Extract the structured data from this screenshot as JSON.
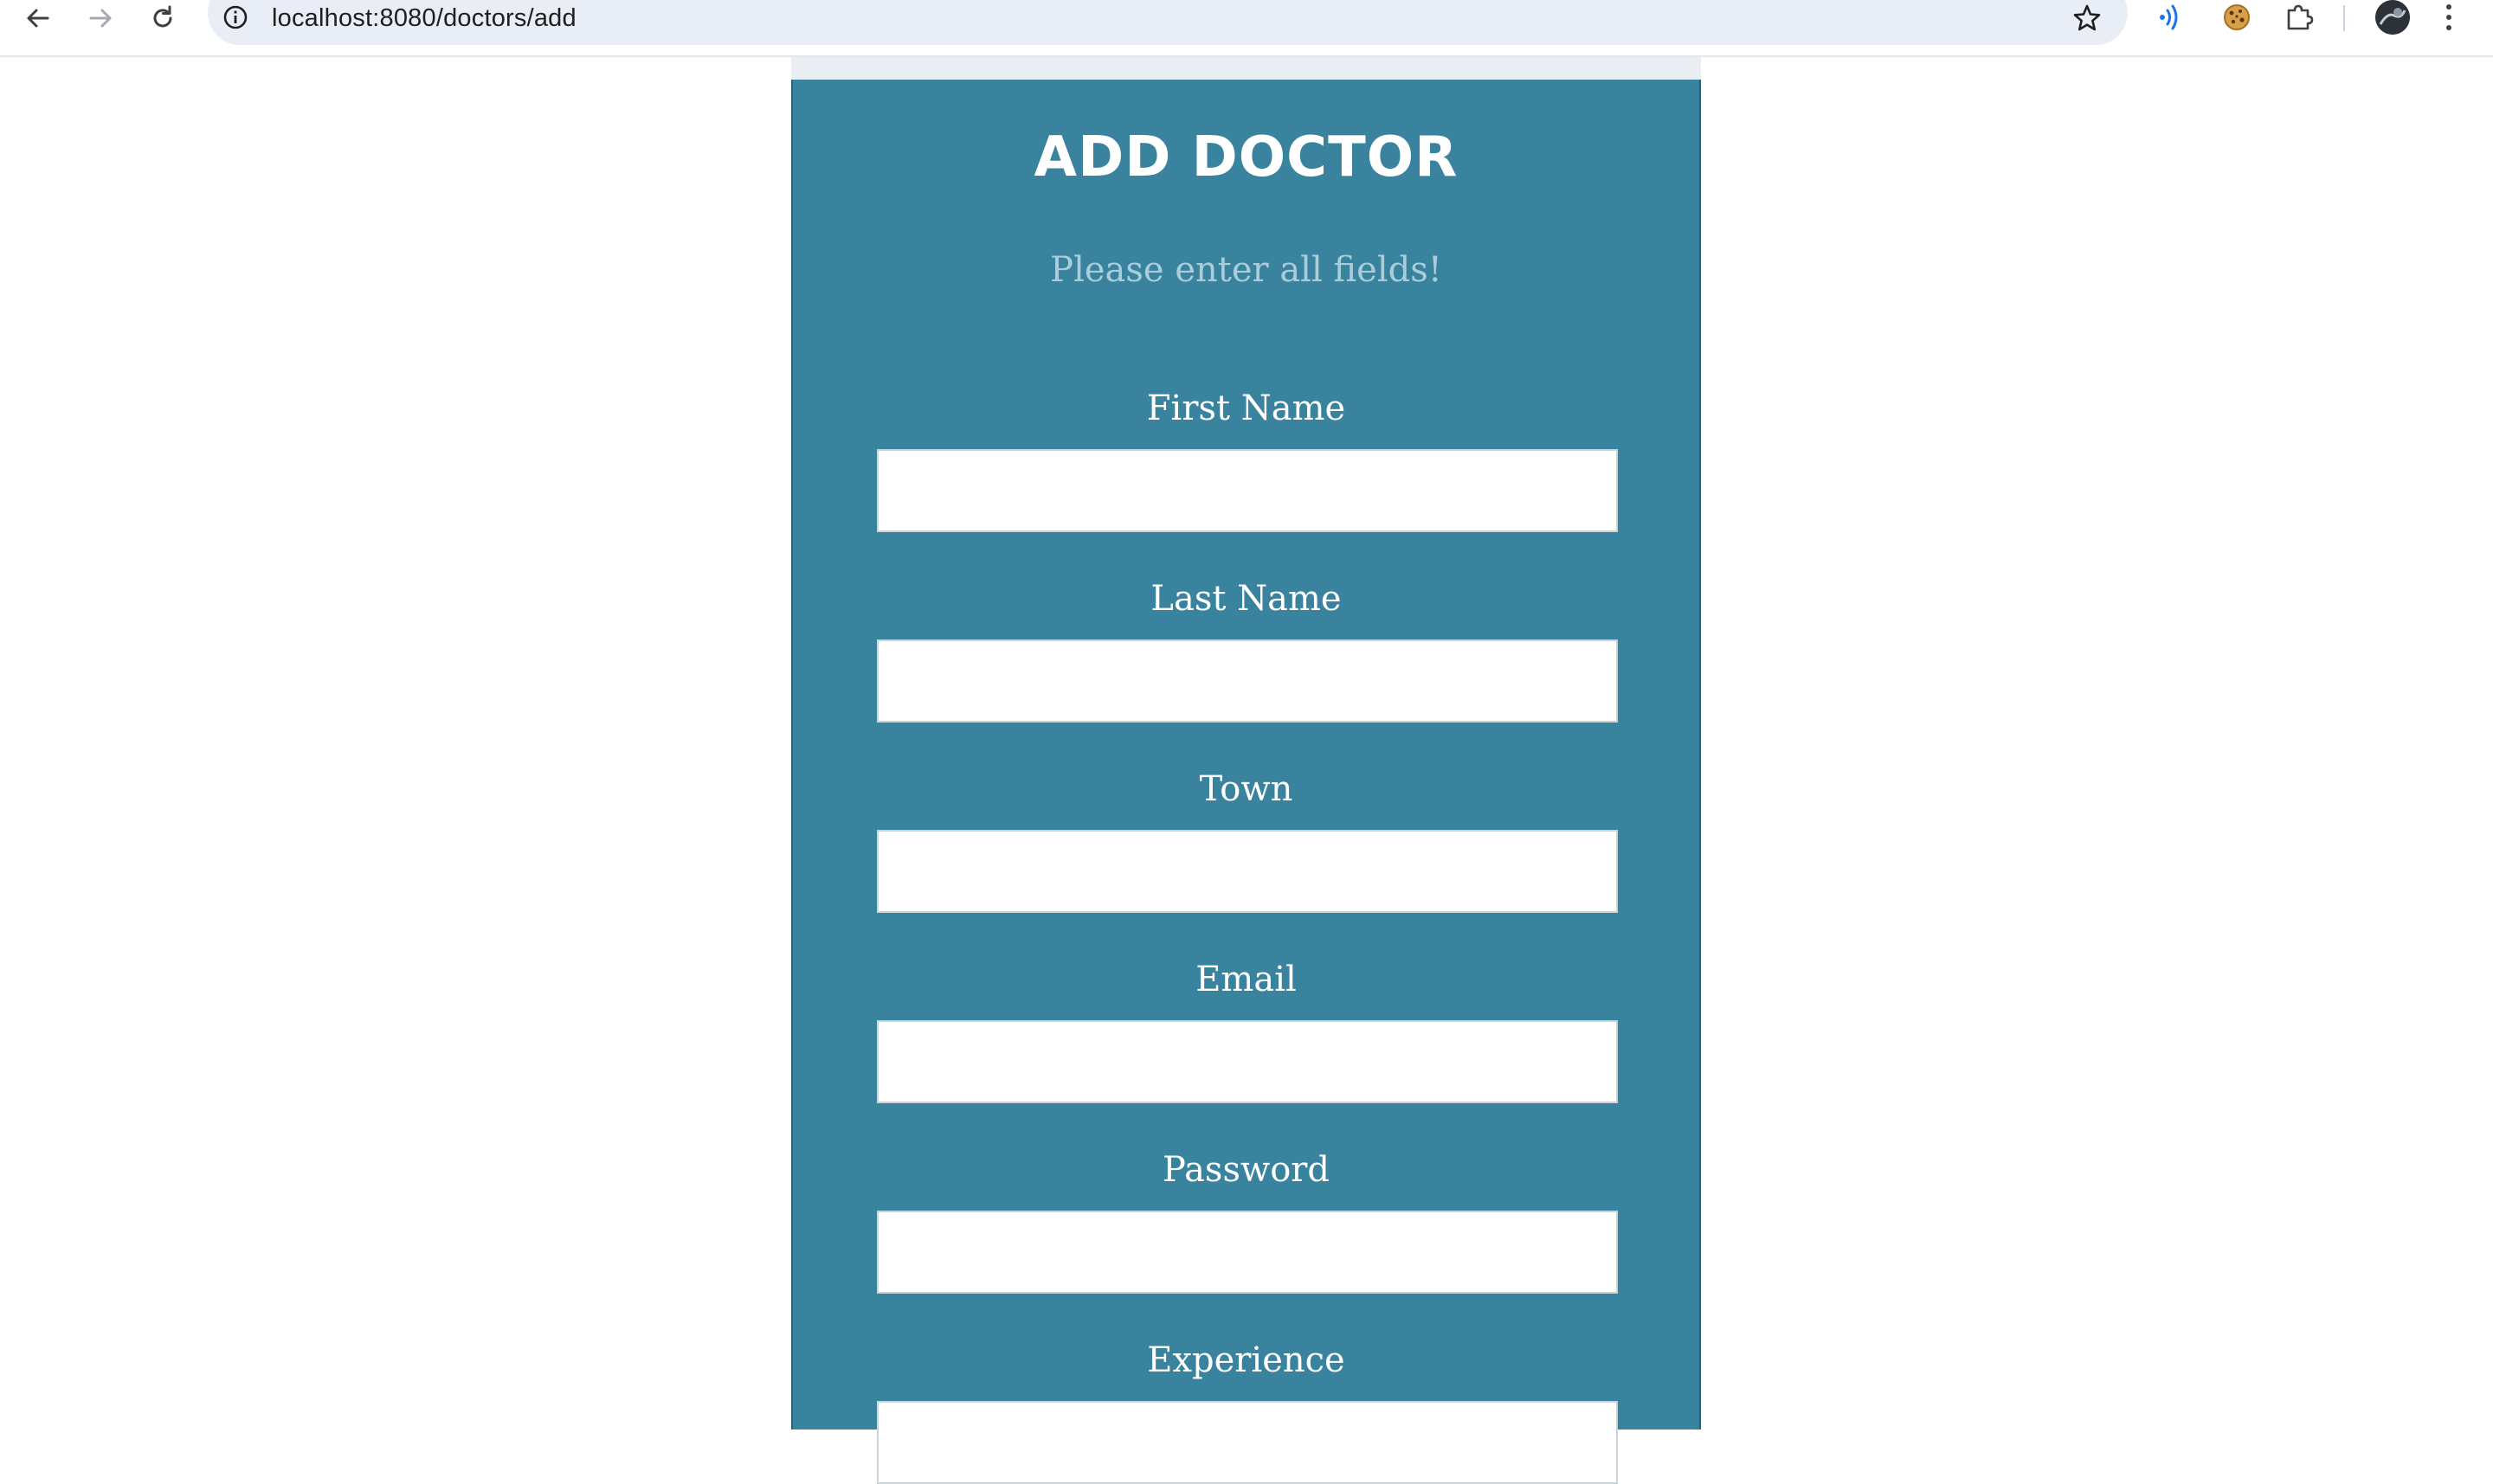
{
  "browser": {
    "url": "localhost:8080/doctors/add",
    "back_icon": "arrow-left-icon",
    "forward_icon": "arrow-right-icon",
    "reload_icon": "reload-icon",
    "info_icon": "info-icon",
    "bookmark_icon": "star-icon",
    "extensions": [
      "read-aloud-icon",
      "cookie-icon",
      "puzzle-piece-icon"
    ],
    "profile_icon": "avatar",
    "menu_icon": "kebab-menu-icon"
  },
  "form": {
    "title": "ADD DOCTOR",
    "subtitle": "Please enter all fields!",
    "fields": [
      {
        "label": "First Name",
        "value": "",
        "type": "text"
      },
      {
        "label": "Last Name",
        "value": "",
        "type": "text"
      },
      {
        "label": "Town",
        "value": "",
        "type": "text"
      },
      {
        "label": "Email",
        "value": "",
        "type": "email"
      },
      {
        "label": "Password",
        "value": "",
        "type": "password"
      },
      {
        "label": "Experience",
        "value": "",
        "type": "text"
      }
    ]
  },
  "colors": {
    "panel_background": "#3a839e",
    "subtitle_text": "#a9cddb",
    "label_text": "#ffffff",
    "page_background": "#ffffff"
  }
}
